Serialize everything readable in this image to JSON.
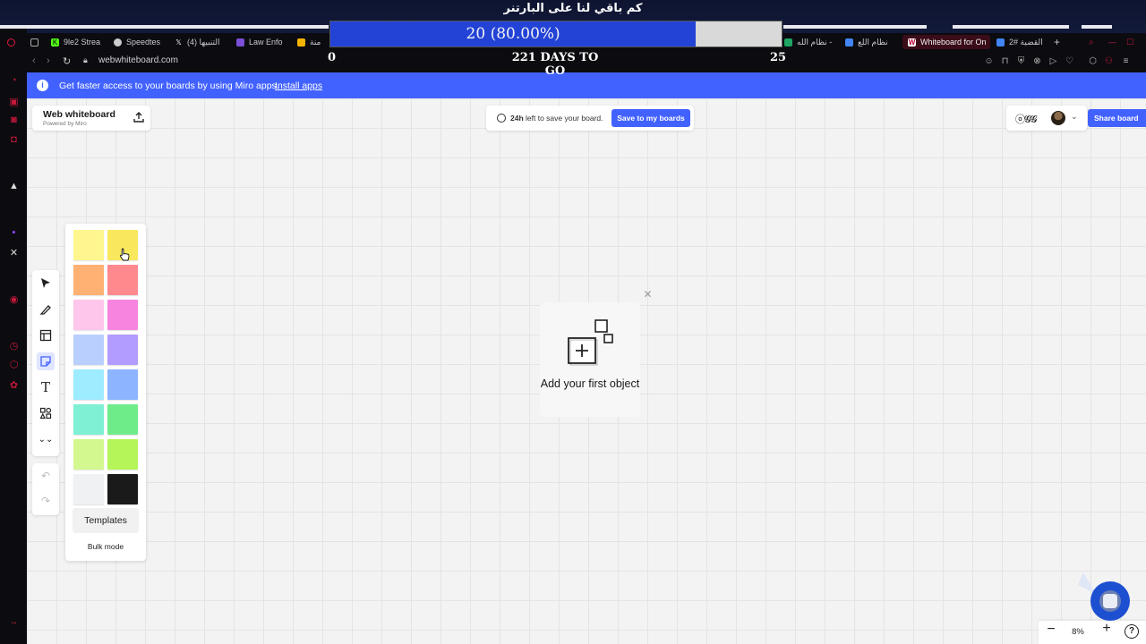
{
  "overlay": {
    "title": "كم باقي لنا على البارتنر",
    "progress_text": "20 (80.00%)",
    "progress_value": 0.81,
    "left_count": "0",
    "days_text": "221 DAYS TO GO",
    "right_count": "25"
  },
  "browser": {
    "tabs": [
      {
        "label": "9le2 Strea",
        "icon": "kick-icon",
        "color": "#53fc18"
      },
      {
        "label": "Speedtes",
        "icon": "github-icon",
        "color": "#cccccc"
      },
      {
        "label": "(4) التنبيها",
        "icon": "x-icon",
        "color": "#ffffff"
      },
      {
        "label": "Law Enfo",
        "icon": "form-icon",
        "color": "#7a4fd6"
      },
      {
        "label": "منة",
        "icon": "slides-icon",
        "color": "#f4b400"
      },
      {
        "label": "نظام الله -",
        "icon": "drive-icon",
        "color": "#1fa463"
      },
      {
        "label": "نظام اللع",
        "icon": "docs-icon",
        "color": "#4285f4"
      },
      {
        "label": "Whiteboard for On",
        "icon": "miro-icon",
        "color": "#ffffff",
        "active": true
      },
      {
        "label": "القضية #2",
        "icon": "docs-icon",
        "color": "#4285f4"
      }
    ],
    "url": "webwhiteboard.com"
  },
  "banner": {
    "message": "Get faster access to your boards by using Miro apps.",
    "install_label": "Install apps"
  },
  "board": {
    "title": "Web whiteboard",
    "subtitle": "Powered by Miro"
  },
  "save": {
    "hours": "24h",
    "message": " left to save your board.",
    "button_label": "Save to my boards"
  },
  "collab": {
    "reactions_glyph": "ⓞ𝓖𝓖",
    "share_label": "Share board"
  },
  "sticky_panel": {
    "colors": [
      "#fff68f",
      "#f9e85d",
      "#ffb173",
      "#ff8a8e",
      "#ffc6ec",
      "#f785e0",
      "#b9d0ff",
      "#b29cff",
      "#9eecff",
      "#8db5ff",
      "#7ff0d3",
      "#6fec8a",
      "#d3f890",
      "#b5f55a",
      "#f0f1f3",
      "#1a1a1a"
    ],
    "templates_label": "Templates",
    "bulk_label": "Bulk mode"
  },
  "first_object": {
    "label": "Add your first object"
  },
  "zoom": {
    "value": "8%"
  }
}
